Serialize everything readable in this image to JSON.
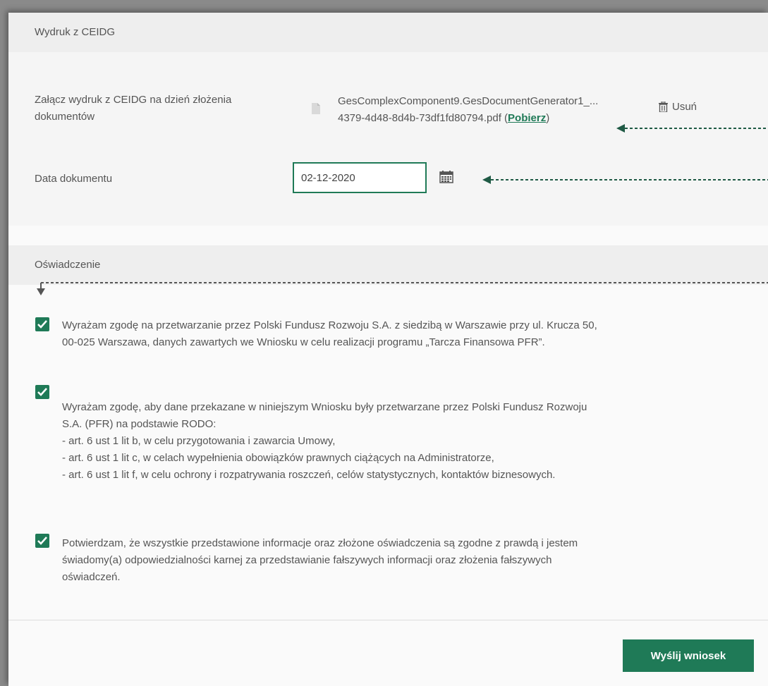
{
  "sections": {
    "ceidg": {
      "title": "Wydruk z CEIDG",
      "attach_label": "Załącz wydruk z CEIDG na dzień złożenia dokumentów",
      "file_name_line1": "GesComplexComponent9.GesDocumentGenerator1_...",
      "file_name_line2": "4379-4d48-8d4b-73df1fd80794.pdf (",
      "download_link": "Pobierz",
      "file_name_close": ")",
      "remove_label": "Usuń",
      "date_label": "Data dokumentu",
      "date_value": "02-12-2020"
    },
    "statement": {
      "title": "Oświadczenie",
      "items": [
        {
          "checked": true,
          "text": "Wyrażam zgodę na przetwarzanie przez Polski Fundusz Rozwoju S.A. z siedzibą w Warszawie przy ul. Krucza 50,\n00-025 Warszawa, danych zawartych we Wniosku w celu realizacji programu „Tarcza Finansowa PFR”."
        },
        {
          "checked": true,
          "text": "Wyrażam zgodę, aby dane przekazane w niniejszym Wniosku były przetwarzane przez Polski Fundusz Rozwoju\nS.A. (PFR) na podstawie RODO:\n- art. 6 ust 1 lit b, w celu przygotowania i zawarcia Umowy,\n- art. 6 ust 1 lit c, w celach wypełnienia obowiązków prawnych ciążących na Administratorze,\n- art. 6 ust 1 lit f, w celu ochrony i rozpatrywania roszczeń, celów statystycznych, kontaktów biznesowych."
        },
        {
          "checked": true,
          "text": "Potwierdzam, że wszystkie przedstawione informacje oraz złożone oświadczenia są zgodne z prawdą i jestem\nświadomy(a) odpowiedzialności karnej za przedstawianie fałszywych informacji oraz złożenia fałszywych\noświadczeń."
        }
      ]
    }
  },
  "submit_label": "Wyślij wniosek",
  "colors": {
    "accent": "#1f7a57",
    "header_bg": "#eeeeee",
    "arrow": "#1f5a45"
  },
  "icons": {
    "file": "file-icon",
    "trash": "trash-icon",
    "calendar": "calendar-icon",
    "check": "checkmark-icon"
  }
}
